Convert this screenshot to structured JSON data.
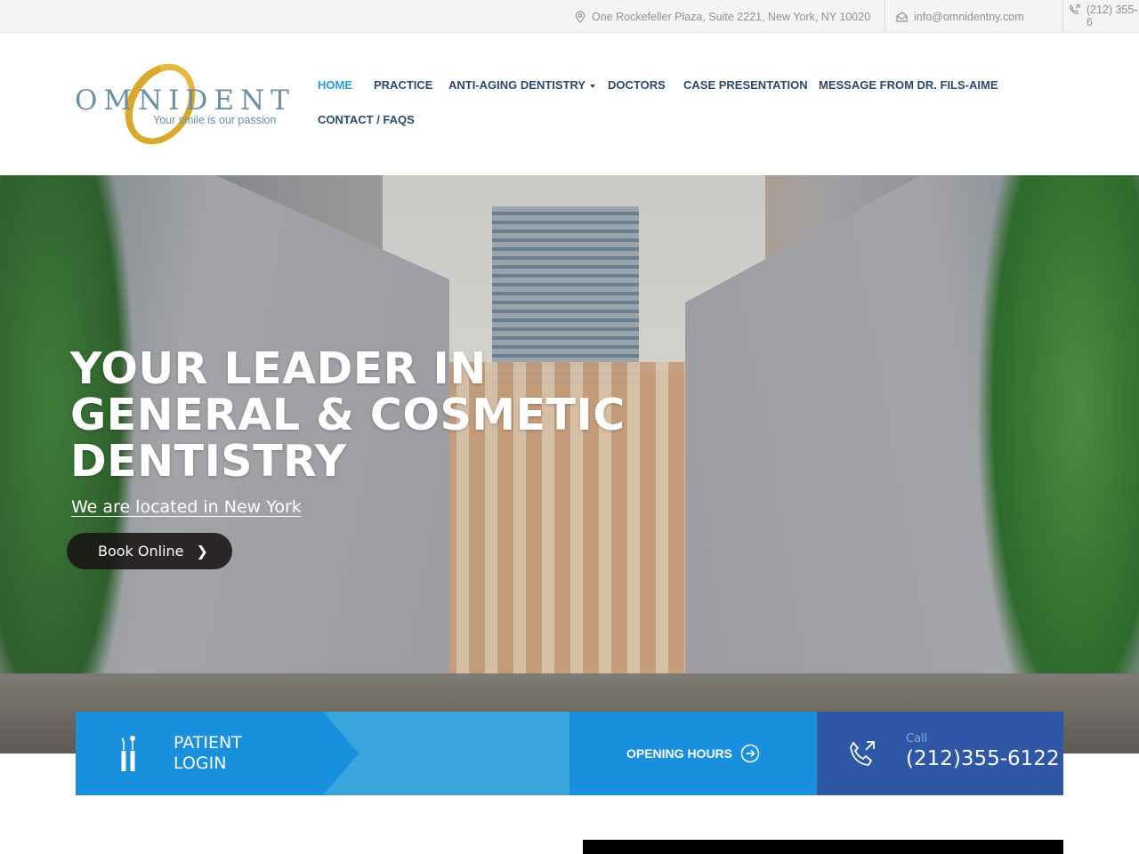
{
  "topbar": {
    "address": "One Rockefeller Plaza, Suite 2221, New York, NY 10020",
    "email": "info@omnidentny.com",
    "phone": "(212) 355-6",
    "icons": {
      "address": "map-pin-icon",
      "email": "envelope-icon",
      "phone": "phone-call-icon"
    }
  },
  "logo": {
    "wordmark": "OMNIDENT",
    "tagline": "Your smile is our passion"
  },
  "nav": {
    "items": [
      {
        "label": "HOME",
        "active": true
      },
      {
        "label": "PRACTICE"
      },
      {
        "label": "ANTI-AGING DENTISTRY",
        "dropdown": true
      },
      {
        "label": "DOCTORS"
      },
      {
        "label": "CASE PRESENTATION"
      },
      {
        "label": "MESSAGE FROM DR. FILS-AIME"
      },
      {
        "label": "CONTACT / FAQS"
      }
    ],
    "active_color": "#2a9bd4",
    "color": "#2e4a6b"
  },
  "hero": {
    "headline": "YOUR LEADER IN GENERAL & COSMETIC DENTISTRY",
    "subheadline": "We are located in New York",
    "cta_label": "Book Online"
  },
  "strip": {
    "patient_login": {
      "line1": "PATIENT",
      "line2": "LOGIN"
    },
    "opening_hours": "OPENING HOURS",
    "call": {
      "label": "Call",
      "number": "(212)355-6122"
    },
    "colors": {
      "primary": "#1890de",
      "light": "#39a5dc",
      "dark": "#2e57a5"
    }
  }
}
